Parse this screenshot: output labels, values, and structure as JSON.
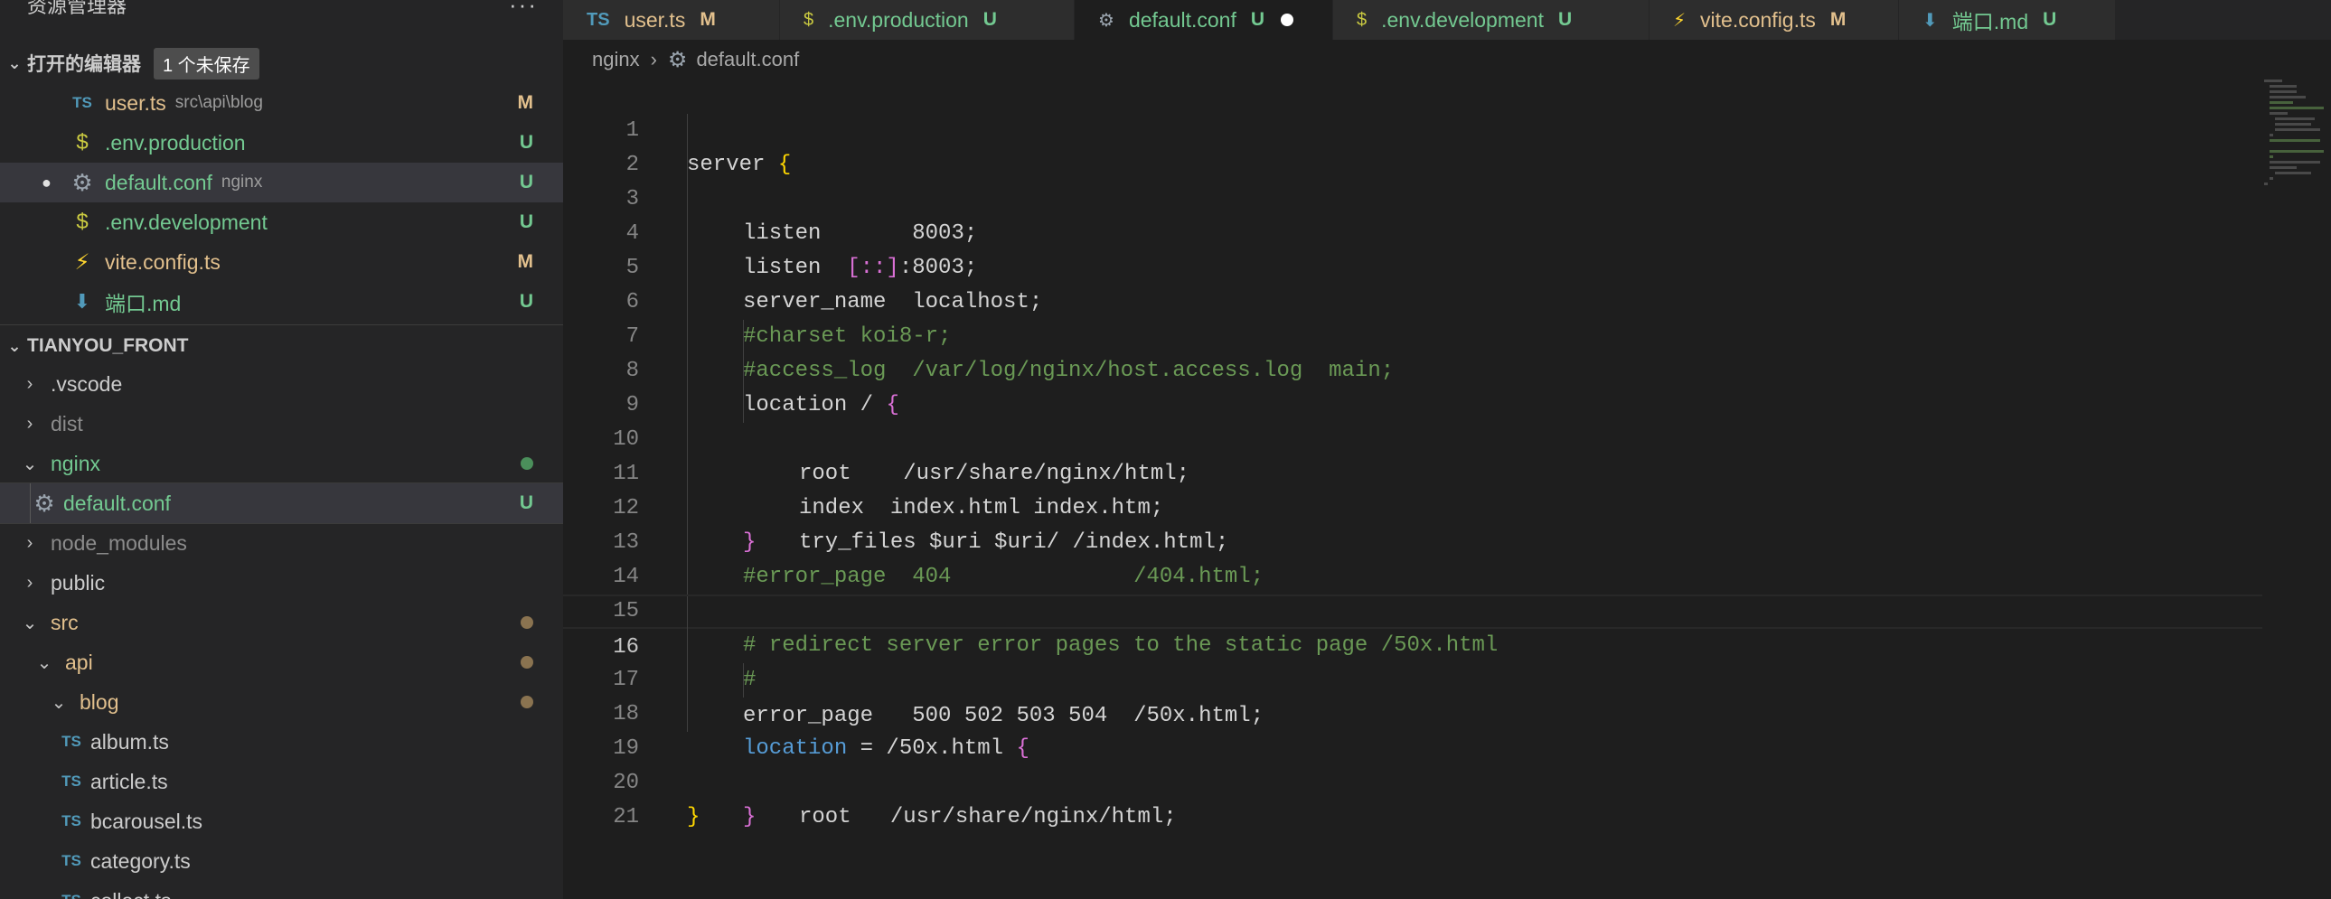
{
  "sidebar": {
    "title": "资源管理器",
    "more": "···",
    "open_editors": {
      "label": "打开的编辑器",
      "badge": "1 个未保存",
      "items": [
        {
          "icon": "TS",
          "name": "user.ts",
          "desc": "src\\api\\blog",
          "status": "M"
        },
        {
          "icon": "$",
          "name": ".env.production",
          "desc": "",
          "status": "U"
        },
        {
          "icon": "⚙",
          "name": "default.conf",
          "desc": "nginx",
          "status": "U"
        },
        {
          "icon": "⚡",
          "name": "vite.config.ts",
          "desc": "",
          "status": "M"
        },
        {
          "icon": "⬇",
          "name": "端口.md",
          "desc": "",
          "status": "U"
        }
      ],
      "item_env_dev": {
        "icon": "$",
        "name": ".env.development",
        "status": "U"
      }
    },
    "workspace": {
      "label": "TIANYOU_FRONT",
      "items": [
        {
          "name": ".vscode"
        },
        {
          "name": "dist"
        },
        {
          "name": "nginx"
        },
        {
          "name": "default.conf",
          "status": "U"
        },
        {
          "name": "node_modules"
        },
        {
          "name": "public"
        },
        {
          "name": "src"
        },
        {
          "name": "api"
        },
        {
          "name": "blog"
        },
        {
          "name": "album.ts",
          "icon": "TS"
        },
        {
          "name": "article.ts",
          "icon": "TS"
        },
        {
          "name": "bcarousel.ts",
          "icon": "TS"
        },
        {
          "name": "category.ts",
          "icon": "TS"
        },
        {
          "name": "collect.ts",
          "icon": "TS"
        }
      ]
    }
  },
  "tabs": [
    {
      "icon": "TS",
      "name": "user.ts",
      "status": "M"
    },
    {
      "icon": "$",
      "name": ".env.production",
      "status": "U"
    },
    {
      "icon": "⚙",
      "name": "default.conf",
      "status": "U"
    },
    {
      "icon": "$",
      "name": ".env.development",
      "status": "U"
    },
    {
      "icon": "⚡",
      "name": "vite.config.ts",
      "status": "M"
    },
    {
      "icon": "⬇",
      "name": "端口.md",
      "status": "U"
    }
  ],
  "breadcrumb": {
    "folder": "nginx",
    "file": "default.conf"
  },
  "editor": {
    "line_numbers": [
      "1",
      "2",
      "3",
      "4",
      "5",
      "6",
      "7",
      "8",
      "9",
      "10",
      "11",
      "12",
      "13",
      "14",
      "15",
      "16",
      "17",
      "18",
      "19",
      "20",
      "21"
    ],
    "lines": {
      "l1_kw": "server ",
      "l1_b": "{",
      "l2": "listen       8003;",
      "l3_a": "listen  ",
      "l3_b": "[::]",
      "l3_c": ":8003;",
      "l4": "server_name  localhost;",
      "l5": "#charset koi8-r;",
      "l6": "#access_log  /var/log/nginx/host.access.log  main;",
      "l7_a": "location / ",
      "l7_b": "{",
      "l8": "root    /usr/share/nginx/html;",
      "l9": "index  index.html index.htm;",
      "l10": "try_files $uri $uri/ /index.html;",
      "l11": "}",
      "l12": "#error_page  404              /404.html;",
      "l14": "# redirect server error pages to the static page /50x.html",
      "l15": "#",
      "l16": "error_page   500 502 503 504  /50x.html;",
      "l17_kw": "location",
      "l17_a": " = /50x.html ",
      "l17_b": "{",
      "l18": "root   /usr/share/nginx/html;",
      "l19": "}",
      "l20": "}"
    }
  },
  "colors": {
    "modified": "#e2c08d",
    "untracked": "#73c991",
    "comment": "#6a9955",
    "brace_level1": "#ffd700",
    "brace_level2": "#da70d6"
  }
}
